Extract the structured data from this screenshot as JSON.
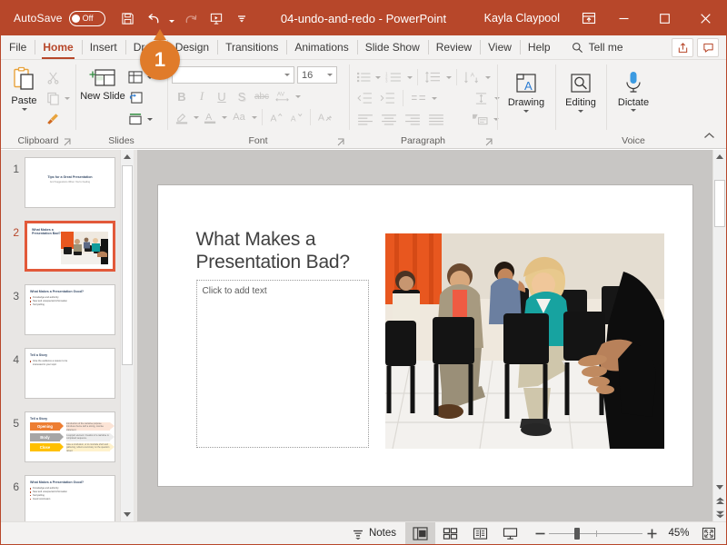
{
  "window": {
    "autosave_label": "AutoSave",
    "autosave_state": "Off",
    "document_title": "04-undo-and-redo",
    "app_name": "PowerPoint",
    "title_separator": "-",
    "account_name": "Kayla Claypool",
    "theme_color": "#b7472a",
    "accent_color": "#e07b2a",
    "quick_access": [
      {
        "name": "save-button",
        "label": "Save"
      },
      {
        "name": "undo-button",
        "label": "Undo"
      },
      {
        "name": "redo-button",
        "label": "Redo"
      },
      {
        "name": "start-presentation-button",
        "label": "Start From Beginning"
      },
      {
        "name": "customize-qat-button",
        "label": "Customize Quick Access Toolbar"
      }
    ],
    "controls": {
      "ribbon_display": "Ribbon Display Options",
      "minimize": "Minimize",
      "maximize": "Maximize",
      "close": "Close"
    }
  },
  "tabs": [
    {
      "label": "File",
      "active": false
    },
    {
      "label": "Home",
      "active": true
    },
    {
      "label": "Insert",
      "active": false
    },
    {
      "label": "Draw",
      "active": false
    },
    {
      "label": "Design",
      "active": false
    },
    {
      "label": "Transitions",
      "active": false
    },
    {
      "label": "Animations",
      "active": false
    },
    {
      "label": "Slide Show",
      "active": false
    },
    {
      "label": "Review",
      "active": false
    },
    {
      "label": "View",
      "active": false
    },
    {
      "label": "Help",
      "active": false
    }
  ],
  "tellme": {
    "label": "Tell me"
  },
  "tabs_right": [
    {
      "name": "share-button",
      "label": "Share"
    },
    {
      "name": "comments-button",
      "label": "Comments"
    }
  ],
  "ribbon": {
    "groups": [
      {
        "name": "clipboard",
        "label": "Clipboard"
      },
      {
        "name": "slides",
        "label": "Slides"
      },
      {
        "name": "font",
        "label": "Font"
      },
      {
        "name": "paragraph",
        "label": "Paragraph"
      },
      {
        "name": "drawing",
        "label": "Drawing"
      },
      {
        "name": "editing",
        "label": "Editing"
      },
      {
        "name": "voice",
        "label": "Voice"
      }
    ],
    "clipboard": {
      "paste_label": "Paste",
      "cut_label": "Cut",
      "copy_label": "Copy",
      "format_painter_label": "Format Painter"
    },
    "slides": {
      "new_slide_label": "New Slide",
      "layout_label": "Layout",
      "reset_label": "Reset",
      "section_label": "Section"
    },
    "font": {
      "font_name_value": "",
      "font_name_placeholder": "",
      "font_size_value": "16",
      "bold_label": "B",
      "italic_label": "I",
      "underline_label": "U",
      "shadow_label": "S",
      "strikethrough_label": "abc",
      "char_spacing_label": "AV",
      "text_highlight_label": "Text Highlight Color",
      "font_color_label": "Font Color",
      "change_case_label": "Aa",
      "increase_size_label": "A",
      "decrease_size_label": "A",
      "clear_formatting_label": "Clear All Formatting"
    },
    "paragraph": {
      "bullets_label": "Bullets",
      "numbering_label": "Numbering",
      "line_spacing_label": "Line Spacing",
      "text_direction_label": "Text Direction",
      "decrease_indent_label": "Decrease List Level",
      "increase_indent_label": "Increase List Level",
      "columns_label": "Columns",
      "align_text_label": "Align Text",
      "align_left_label": "Align Left",
      "align_center_label": "Center",
      "align_right_label": "Align Right",
      "justify_label": "Justify",
      "smartart_label": "Convert to SmartArt"
    },
    "drawing": {
      "label": "Drawing"
    },
    "editing": {
      "label": "Editing"
    },
    "voice": {
      "dictate_label": "Dictate"
    },
    "collapse_label": "Collapse the Ribbon"
  },
  "callout": {
    "number": "1"
  },
  "thumbnails": [
    {
      "number": "1",
      "selected": false,
      "layout": "title",
      "title": "Tips for a Great Presentation",
      "subtitle": "And Suggestions When You're Feeling"
    },
    {
      "number": "2",
      "selected": true,
      "layout": "title-photo",
      "title": "What Makes a Presentation Bad?"
    },
    {
      "number": "3",
      "selected": false,
      "layout": "bullets",
      "title": "What Makes a Presentation Good?",
      "bullets": [
        "Knowledge and authority",
        "New and unexpected information",
        "Storytelling"
      ]
    },
    {
      "number": "4",
      "selected": false,
      "layout": "bullets",
      "title": "Tell a Story",
      "bullets": [
        "Give the audience a reason to be interested in your topic"
      ]
    },
    {
      "number": "5",
      "selected": false,
      "layout": "chevrons",
      "title": "Tell a Story",
      "chevrons": [
        {
          "label": "Opening",
          "text": "Introduction of the narrative purpose. Introduce theme with a strong, concise statement."
        },
        {
          "label": "Body",
          "text": "A support element. Creation of a narrative is completed sequence."
        },
        {
          "label": "Close",
          "text": "Give a conclusion, or to conclude short and gathering, reflect a summary on the question raised."
        }
      ]
    },
    {
      "number": "6",
      "selected": false,
      "layout": "bullets",
      "title": "What Makes a Presentation Good?",
      "bullets": [
        "Knowledge and authority",
        "New and unexpected information",
        "Storytelling",
        "Good conclusion"
      ]
    }
  ],
  "slide": {
    "title": "What Makes a\nPresentation Bad?",
    "title_line1": "What Makes a",
    "title_line2": "Presentation Bad?",
    "body_placeholder": "Click to add text",
    "photo_alt": "Bored audience sleeping in conference chairs"
  },
  "statusbar": {
    "notes_label": "Notes",
    "views": [
      {
        "name": "normal-view-button",
        "label": "Normal",
        "active": true
      },
      {
        "name": "slide-sorter-button",
        "label": "Slide Sorter",
        "active": false
      },
      {
        "name": "reading-view-button",
        "label": "Reading View",
        "active": false
      },
      {
        "name": "slideshow-button",
        "label": "Slide Show",
        "active": false
      }
    ],
    "zoom_out_label": "Zoom Out",
    "zoom_in_label": "Zoom In",
    "zoom_level": "45%",
    "fit_label": "Fit slide to current window"
  }
}
